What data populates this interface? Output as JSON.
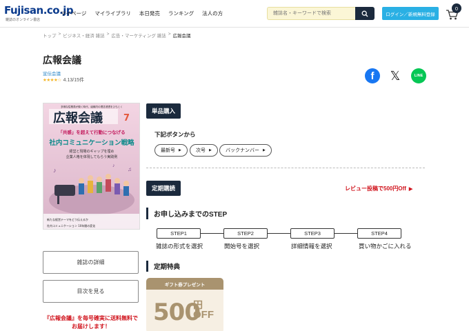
{
  "header": {
    "logo": "Fujisan.co.jp",
    "logo_sub": "雑誌のオンライン書店",
    "nav": [
      "マイページ",
      "マイライブラリ",
      "本日発売",
      "ランキング",
      "法人の方"
    ],
    "search_placeholder": "雑誌名・キーワードで検索",
    "login_label": "ログイン／新規無料登録",
    "cart_count": "0"
  },
  "breadcrumb": [
    "トップ",
    "ビジネス・経済 雑誌",
    "広告・マーケティング 雑誌",
    "広報会議"
  ],
  "product": {
    "title": "広報会議",
    "publisher": "宣伝会議",
    "rating_value": 4.13,
    "rating_text": "4.13/15件"
  },
  "cover": {
    "tagline": "多様な従業員が働く時代、組織内の理念浸透をひもとく",
    "title": "広報会議",
    "issue": "7",
    "feature_top": "「共感」を超えて行動につなげる",
    "feature_main": "社内コミュニケーション戦略",
    "feature_sub1": "経営と現場のギャップを埋め",
    "feature_sub2": "企業人格を体現してもらう実践例",
    "footer1": "新たな経営テーマをどう伝えるか",
    "footer2": "社内コミュニケーション 10年間の変化"
  },
  "sidebar": {
    "details_button": "雑誌の詳細",
    "toc_button": "目次を見る",
    "note": "『広報会議』を毎号確実に送料無料でお届けします！"
  },
  "single_purchase": {
    "header": "単品購入",
    "prompt": "下記ボタンから",
    "buttons": [
      "最新号",
      "次号",
      "バックナンバー"
    ]
  },
  "subscription": {
    "header": "定期購読",
    "review_promo": "レビュー投稿で500円Off",
    "steps_title": "お申し込みまでのSTEP",
    "steps": [
      {
        "label": "STEP1",
        "caption": "雑誌の形式を選択"
      },
      {
        "label": "STEP2",
        "caption": "開始号を選択"
      },
      {
        "label": "STEP3",
        "caption": "詳細情報を選択"
      },
      {
        "label": "STEP4",
        "caption": "買い物かごに入れる"
      }
    ],
    "perk_title": "定期特典",
    "gift_header": "ギフト券プレゼント",
    "gift_amount": "500",
    "gift_yen": "円",
    "gift_off": "OFF"
  },
  "colors": {
    "navy": "#1b2a3d",
    "accent_blue": "#2ab0e4",
    "promo_red": "#d0121b",
    "gift_gold": "#a9936f",
    "cover_bg": "#e8c6d8"
  }
}
